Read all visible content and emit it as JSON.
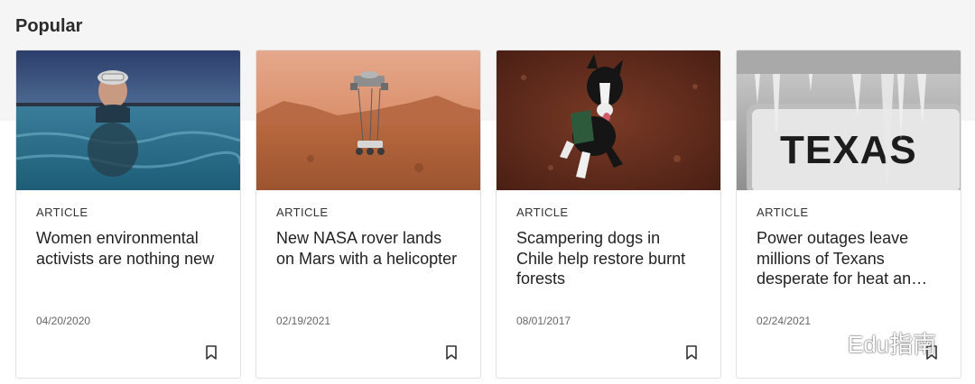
{
  "section": {
    "title": "Popular"
  },
  "cards": [
    {
      "type": "ARTICLE",
      "title": "Women environmental activists are nothing new",
      "date": "04/20/2020",
      "image_icon": "swimmer-photo",
      "bookmark_icon": "bookmark-icon"
    },
    {
      "type": "ARTICLE",
      "title": "New NASA rover lands on Mars with a helicopter",
      "date": "02/19/2021",
      "image_icon": "mars-rover-photo",
      "bookmark_icon": "bookmark-icon"
    },
    {
      "type": "ARTICLE",
      "title": "Scampering dogs in Chile help restore burnt forests",
      "date": "08/01/2017",
      "image_icon": "dog-photo",
      "bookmark_icon": "bookmark-icon"
    },
    {
      "type": "ARTICLE",
      "title": "Power outages leave millions of Texans desperate for heat an…",
      "date": "02/24/2021",
      "image_icon": "icy-license-plate-photo",
      "bookmark_icon": "bookmark-icon"
    }
  ],
  "photo_text": {
    "plate": "TEXAS"
  },
  "watermark": {
    "text": "Edu指南"
  }
}
